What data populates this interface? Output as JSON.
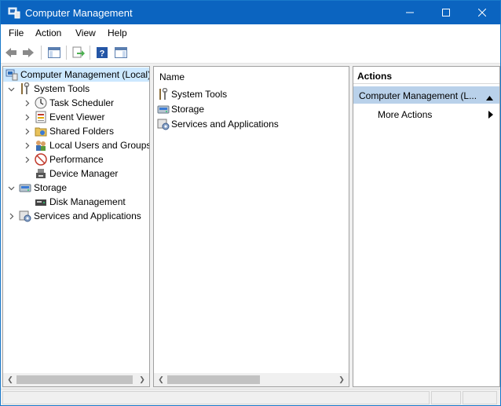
{
  "window": {
    "title": "Computer Management"
  },
  "menu": [
    "File",
    "Action",
    "View",
    "Help"
  ],
  "tree": {
    "root": "Computer Management (Local)",
    "system_tools": "System Tools",
    "task_scheduler": "Task Scheduler",
    "event_viewer": "Event Viewer",
    "shared_folders": "Shared Folders",
    "local_users": "Local Users and Groups",
    "performance": "Performance",
    "device_manager": "Device Manager",
    "storage": "Storage",
    "disk_management": "Disk Management",
    "services_apps": "Services and Applications"
  },
  "list": {
    "column_name": "Name",
    "items": [
      "System Tools",
      "Storage",
      "Services and Applications"
    ]
  },
  "actions": {
    "header": "Actions",
    "section": "Computer Management (L...",
    "more": "More Actions"
  },
  "colors": {
    "title_bar": "#0b64c0",
    "selection": "#cce8ff",
    "action_section": "#b9d1ea"
  }
}
